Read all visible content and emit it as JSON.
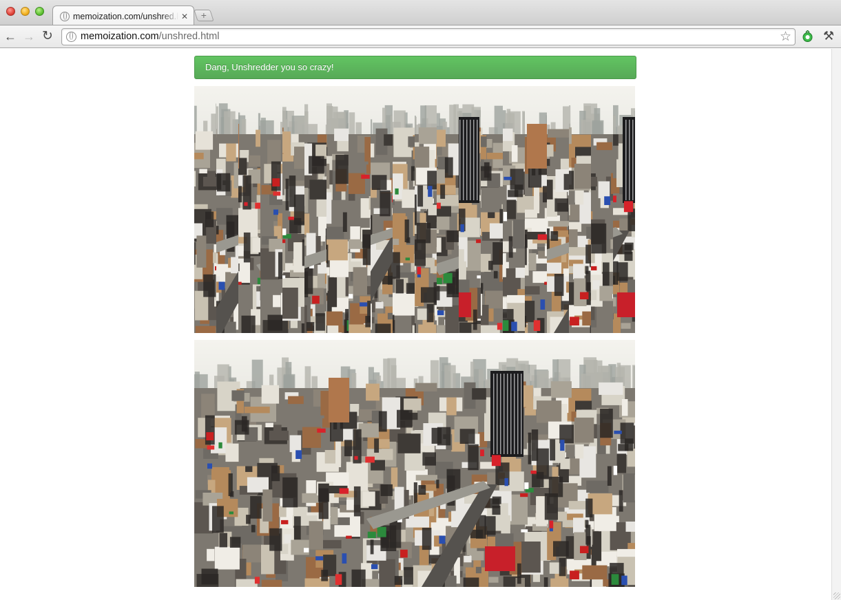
{
  "browser": {
    "tab_title": "memoization.com/unshred.h",
    "tab_close": "✕",
    "new_tab": "+",
    "url_domain": "memoization.com",
    "url_path": "/unshred.html",
    "back_icon": "←",
    "forward_icon": "→",
    "reload_icon": "↻",
    "star_icon": "☆",
    "wrench_icon": "🔧"
  },
  "page": {
    "alert_message": "Dang, Unshredder you so crazy!",
    "alert_color": "#5eb95e",
    "images": [
      {
        "name": "shredded-image",
        "state": "shredded"
      },
      {
        "name": "unshredded-image",
        "state": "unshredded"
      }
    ]
  }
}
